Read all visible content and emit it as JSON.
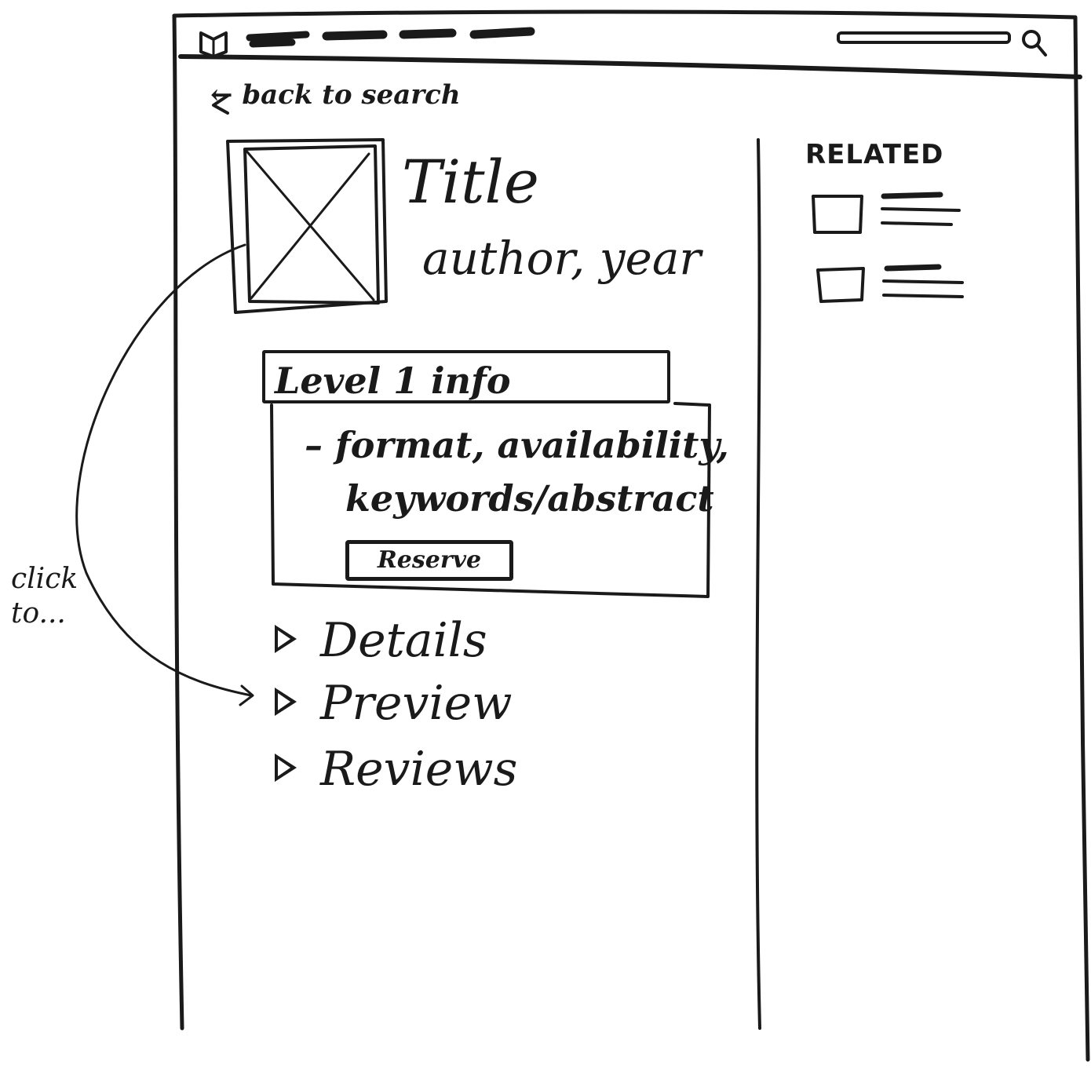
{
  "header": {
    "logo_icon": "book-icon",
    "nav_items": [
      "",
      "",
      "",
      ""
    ],
    "search": {
      "placeholder": "",
      "icon": "search-icon"
    }
  },
  "back_link": {
    "label": "← back to search",
    "icon": "arrow-left-icon"
  },
  "item": {
    "title": "Title",
    "author_year": "author, year",
    "cover_image": "image-placeholder-icon"
  },
  "level1": {
    "heading": "Level 1 info",
    "bullet": "–",
    "line1": "format, availability,",
    "line2": "keywords/abstract",
    "reserve_label": "Reserve"
  },
  "accordions": [
    {
      "label": "Details"
    },
    {
      "label": "Preview"
    },
    {
      "label": "Reviews"
    }
  ],
  "annotation": {
    "line1": "click",
    "line2": "to..."
  },
  "related": {
    "heading": "RELATED",
    "items": [
      {
        "thumbnail": "thumbnail-placeholder-icon"
      },
      {
        "thumbnail": "thumbnail-placeholder-icon"
      }
    ]
  }
}
